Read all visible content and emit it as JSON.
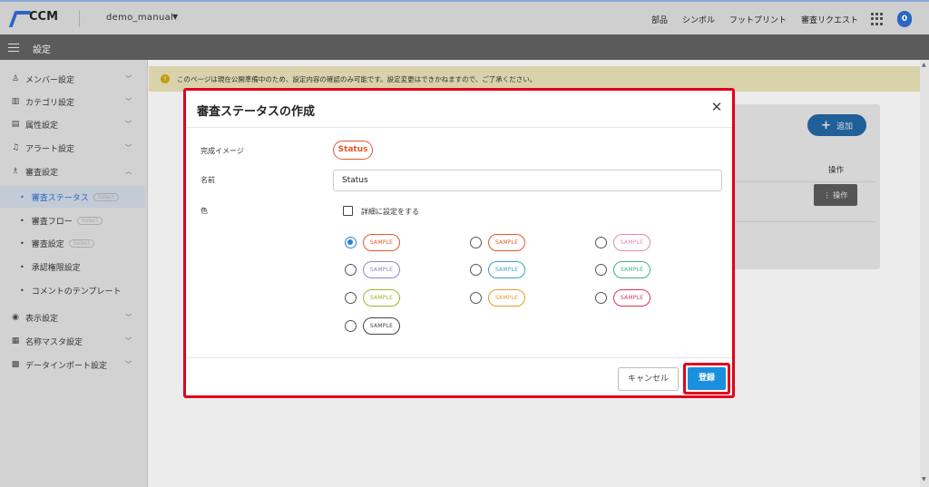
{
  "header": {
    "logo": "CCM",
    "project": "demo_manual",
    "nav": [
      "部品",
      "シンボル",
      "フットプリント",
      "審査リクエスト"
    ],
    "avatar_letter": "0"
  },
  "settings_bar": {
    "title": "設定"
  },
  "sidebar": {
    "items": [
      {
        "icon": "person-icon",
        "glyph": "♙",
        "label": "メンバー設定"
      },
      {
        "icon": "list-icon",
        "glyph": "▥",
        "label": "カテゴリ設定"
      },
      {
        "icon": "attribute-icon",
        "glyph": "▤",
        "label": "属性設定"
      },
      {
        "icon": "bell-icon",
        "glyph": "♫",
        "label": "アラート設定"
      },
      {
        "icon": "review-icon",
        "glyph": "♗",
        "label": "審査設定"
      }
    ],
    "sub_items": [
      {
        "label": "審査ステータス",
        "badge": "Select"
      },
      {
        "label": "審査フロー",
        "badge": "Select"
      },
      {
        "label": "審査設定",
        "badge": "Select"
      },
      {
        "label": "承認権限設定",
        "badge": ""
      },
      {
        "label": "コメントのテンプレート",
        "badge": ""
      }
    ],
    "bottom_items": [
      {
        "icon": "eye-icon",
        "glyph": "◉",
        "label": "表示設定"
      },
      {
        "icon": "master-icon",
        "glyph": "▦",
        "label": "名称マスタ設定"
      },
      {
        "icon": "import-icon",
        "glyph": "▩",
        "label": "データインポート設定"
      }
    ]
  },
  "notice": {
    "icon_glyph": "!",
    "text": "このページは現在公開準備中のため、設定内容の確認のみ可能です。設定変更はできかねますので、ご了承ください。"
  },
  "background": {
    "add_label": "追加",
    "column_header": "操作",
    "op_button": "⋮ 操作"
  },
  "modal": {
    "title": "審査ステータスの作成",
    "close_glyph": "✕",
    "preview_label": "完成イメージ",
    "preview_status": "Status",
    "name_label": "名前",
    "name_value": "Status",
    "color_label": "色",
    "advanced_label": "詳細に設定をする",
    "sample_label": "SAMPLE",
    "colors": [
      {
        "color": "#e4572e",
        "selected": true
      },
      {
        "color": "#e4572e",
        "selected": false
      },
      {
        "color": "#e88aa8",
        "selected": false
      },
      {
        "color": "#8b87c8",
        "selected": false
      },
      {
        "color": "#3fa0c8",
        "selected": false
      },
      {
        "color": "#3cb878",
        "selected": false
      },
      {
        "color": "#9cb82a",
        "selected": false
      },
      {
        "color": "#e89a2a",
        "selected": false
      },
      {
        "color": "#d8365a",
        "selected": false
      },
      {
        "color": "#444444",
        "selected": false
      }
    ],
    "cancel_label": "キャンセル",
    "submit_label": "登録"
  }
}
